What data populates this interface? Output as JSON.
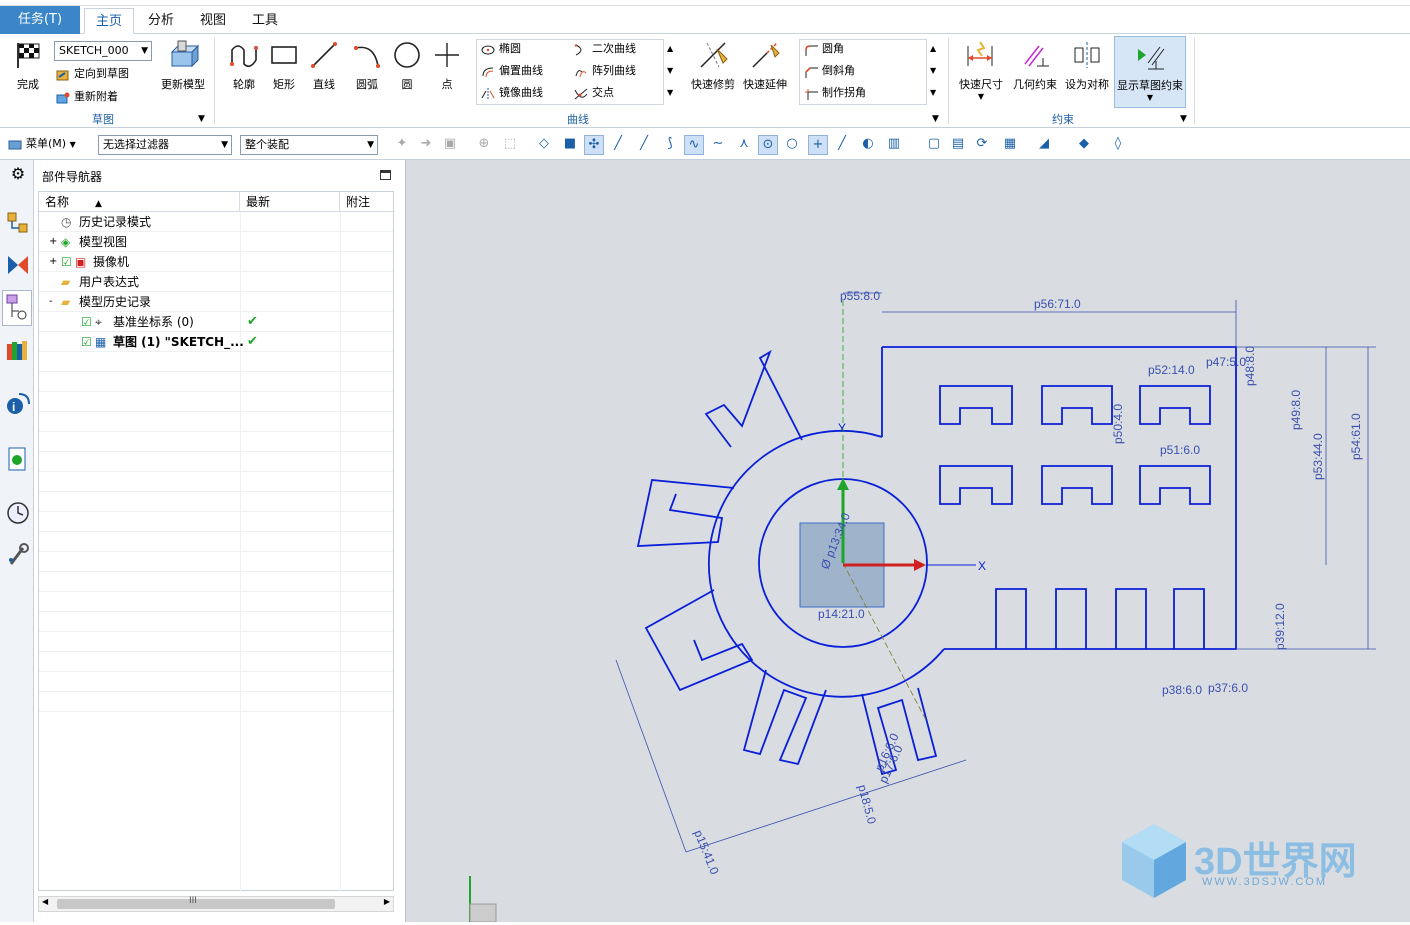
{
  "tabs": {
    "task": "任务(T)",
    "home": "主页",
    "analysis": "分析",
    "view": "视图",
    "tools": "工具"
  },
  "ribbon": {
    "sketch_group": {
      "label": "草图",
      "finish": "完成",
      "sketch_name": "SKETCH_000",
      "orient_to_sketch": "定向到草图",
      "reattach": "重新附着",
      "update_model": "更新模型"
    },
    "curve_group": {
      "label": "曲线",
      "profile": "轮廓",
      "rectangle": "矩形",
      "line": "直线",
      "arc": "圆弧",
      "circle": "圆",
      "point": "点",
      "ellipse": "椭圆",
      "conic": "二次曲线",
      "offset_curve": "偏置曲线",
      "pattern_curve": "阵列曲线",
      "mirror_curve": "镜像曲线",
      "intersection": "交点",
      "quick_trim": "快速修剪",
      "quick_extend": "快速延伸",
      "fillet": "圆角",
      "chamfer": "倒斜角",
      "make_corner": "制作拐角"
    },
    "constraint_group": {
      "label": "约束",
      "rapid_dimension": "快速尺寸",
      "geometric_constraint": "几何约束",
      "make_symmetric": "设为对称",
      "show_sketch_constraints": "显示草图约束"
    }
  },
  "selection_bar": {
    "menu": "菜单(M)",
    "filter": "无选择过滤器",
    "scope": "整个装配"
  },
  "navigator": {
    "title": "部件导航器",
    "columns": [
      "名称",
      "最新",
      "附注"
    ],
    "rows": [
      {
        "label": "历史记录模式",
        "icon": "clock-icon",
        "expand": "",
        "checkbox": false,
        "latest": ""
      },
      {
        "label": "模型视图",
        "icon": "model-view-icon",
        "expand": "+",
        "checkbox": false,
        "latest": ""
      },
      {
        "label": "摄像机",
        "icon": "camera-icon",
        "expand": "+",
        "checkbox": true,
        "latest": ""
      },
      {
        "label": "用户表达式",
        "icon": "folder-icon",
        "expand": "",
        "checkbox": false,
        "latest": ""
      },
      {
        "label": "模型历史记录",
        "icon": "folder-open-icon",
        "expand": "-",
        "checkbox": false,
        "latest": ""
      },
      {
        "label": "基准坐标系 (0)",
        "icon": "datum-csys-icon",
        "expand": "",
        "checkbox": true,
        "latest": "✔"
      },
      {
        "label": "草图 (1) \"SKETCH_...",
        "icon": "sketch-icon",
        "expand": "",
        "checkbox": true,
        "latest": "✔",
        "bold": true
      }
    ],
    "scroll_marker": "III"
  },
  "canvas": {
    "dimensions": {
      "p55": "p55:8.0",
      "p56": "p56:71.0",
      "p52": "p52:14.0",
      "p47": "p47:5.0",
      "p48": "p48:8.0",
      "p49": "p49:8.0",
      "p50": "p50:4.0",
      "p51": "p51:6.0",
      "p53": "p53:44.0",
      "p54": "p54:61.0",
      "p39": "p39:12.0",
      "p38": "p38:6.0",
      "p37": "p37:6.0",
      "p14": "p14:21.0",
      "p13": "Ø p13:34.0",
      "p15": "p15:41.0",
      "p16": "p16:6.0",
      "p17": "p17:6.0",
      "p18": "p18:5.0"
    },
    "axis_x": "X",
    "axis_y": "Y"
  },
  "watermark": {
    "title": "3D世界网",
    "url": "WWW.3DSJW.COM"
  },
  "colors": {
    "accent": "#3a86c8",
    "sketch": "#0a1fd8",
    "dimension": "#3a4fb0",
    "canvas_bg": "#d9dde1"
  }
}
